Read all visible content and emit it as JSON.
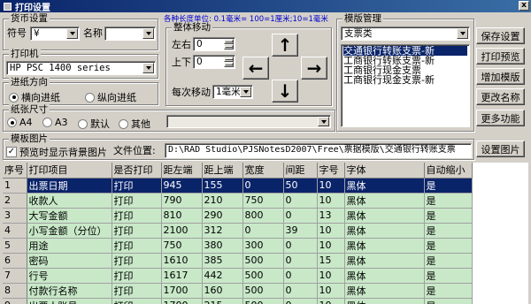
{
  "window": {
    "title": "打印设置",
    "close_label": "x"
  },
  "currency": {
    "legend": "货币设置",
    "symbol_label": "符号",
    "symbol_value": "¥",
    "name_label": "名称",
    "name_value": ""
  },
  "printer": {
    "legend": "打印机",
    "value": "HP PSC 1400 series"
  },
  "direction": {
    "legend": "进纸方向",
    "options": [
      "横向进纸",
      "纵向进纸"
    ],
    "selected": 0
  },
  "paper": {
    "legend": "纸张尺寸",
    "options": [
      "A4",
      "A3",
      "默认",
      "其他"
    ],
    "selected": 0,
    "other_value": ""
  },
  "hint": "各种长度单位: 0.1毫米= 100=1厘米;10=1毫米",
  "move": {
    "legend": "整体移动",
    "left_right_label": "左右",
    "left_right_value": "0",
    "up_down_label": "上下",
    "up_down_value": "0",
    "step_label": "每次移动",
    "step_value": "1毫米",
    "arrows": {
      "up": "↑",
      "left": "←",
      "right": "→",
      "down": "↓"
    }
  },
  "template": {
    "legend": "模版管理",
    "category": "支票类",
    "items": [
      "交通银行转账支票-新",
      "工商银行转账支票-新",
      "工商银行现金支票",
      "工商银行现金支票-新"
    ],
    "selected": 0
  },
  "buttons": {
    "save": "保存设置",
    "preview": "打印预览",
    "add_template": "增加模版",
    "rename": "更改名称",
    "more": "更多功能",
    "set_image": "设置图片"
  },
  "template_image": {
    "legend": "模板图片",
    "preview_bg_label": "预览时显示背景图片",
    "preview_bg_checked": true,
    "path_label": "文件位置:",
    "path_value": "D:\\RAD Studio\\PJSNotesD2007\\Free\\票据模版\\交通银行转账支票"
  },
  "table": {
    "headers": [
      "序号",
      "打印项目",
      "是否打印",
      "距左端",
      "距上端",
      "宽度",
      "间距",
      "字号",
      "字体",
      "自动缩小"
    ],
    "rows": [
      [
        "1",
        "出票日期",
        "打印",
        "945",
        "155",
        "0",
        "50",
        "10",
        "黑体",
        "是"
      ],
      [
        "2",
        "收款人",
        "打印",
        "790",
        "210",
        "750",
        "0",
        "10",
        "黑体",
        "是"
      ],
      [
        "3",
        "大写金额",
        "打印",
        "810",
        "290",
        "800",
        "0",
        "13",
        "黑体",
        "是"
      ],
      [
        "4",
        "小写金额（分位）",
        "打印",
        "2100",
        "312",
        "0",
        "39",
        "10",
        "黑体",
        "是"
      ],
      [
        "5",
        "用途",
        "打印",
        "750",
        "380",
        "300",
        "0",
        "10",
        "黑体",
        "是"
      ],
      [
        "6",
        "密码",
        "打印",
        "1610",
        "385",
        "500",
        "0",
        "15",
        "黑体",
        "是"
      ],
      [
        "7",
        "行号",
        "打印",
        "1617",
        "442",
        "500",
        "0",
        "10",
        "黑体",
        "是"
      ],
      [
        "8",
        "付款行名称",
        "打印",
        "1700",
        "160",
        "500",
        "0",
        "10",
        "黑体",
        "是"
      ],
      [
        "9",
        "出票人账号",
        "打印",
        "1700",
        "215",
        "500",
        "0",
        "10",
        "黑体",
        "是"
      ]
    ],
    "selected_row": 0
  }
}
